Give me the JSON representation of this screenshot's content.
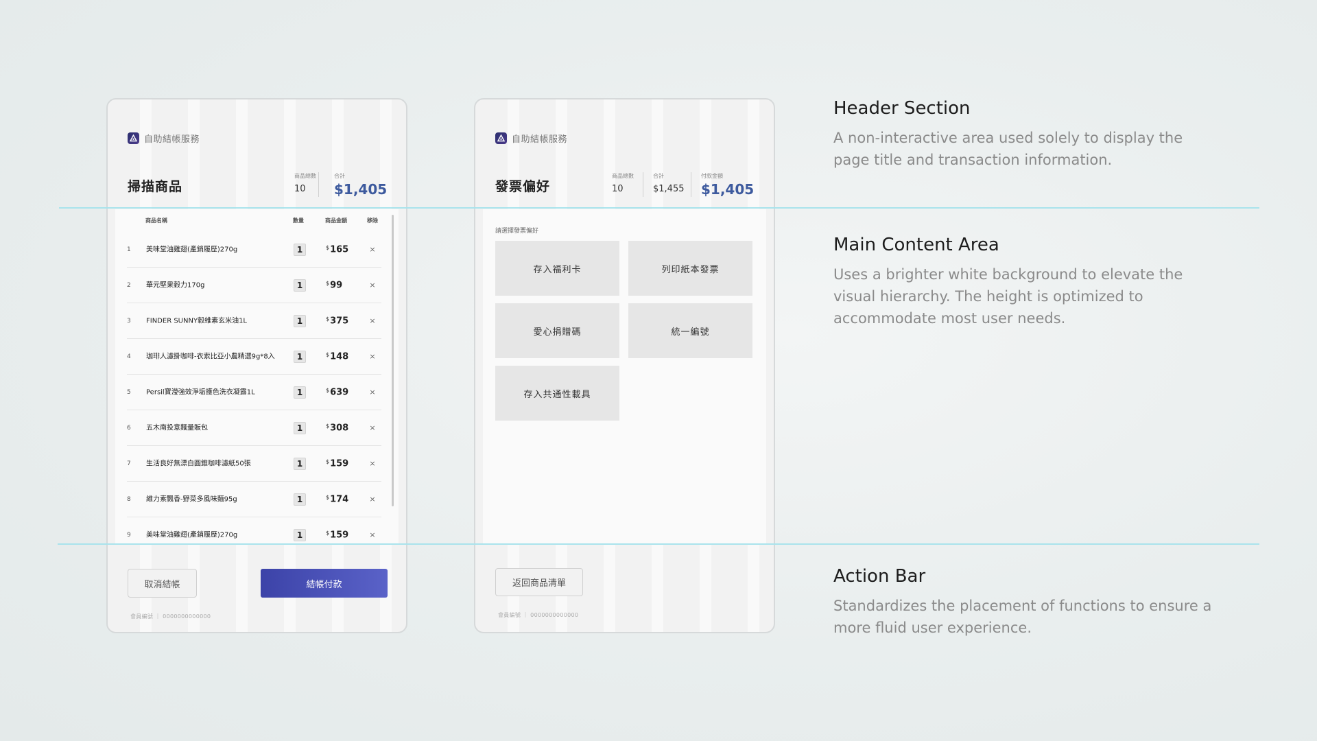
{
  "service_name": "自助結帳服務",
  "screen1": {
    "title": "掃描商品",
    "total_items_label": "商品總數",
    "total_items": "10",
    "total_label": "合計",
    "total": "$1,405",
    "columns": {
      "name": "商品名稱",
      "qty": "數量",
      "amount": "商品金額",
      "remove": "移除"
    },
    "items": [
      {
        "no": "1",
        "name": "美味堂油雞翅(產銷履歷)270g",
        "qty": "1",
        "price": "165"
      },
      {
        "no": "2",
        "name": "華元堅果穀力170g",
        "qty": "1",
        "price": "99"
      },
      {
        "no": "3",
        "name": "FINDER SUNNY穀維素玄米油1L",
        "qty": "1",
        "price": "375"
      },
      {
        "no": "4",
        "name": "珈琲人濾掛咖啡-衣索比亞小農精選9g*8入",
        "qty": "1",
        "price": "148"
      },
      {
        "no": "5",
        "name": "Persil寶瀅強效淨垢護色洗衣凝露1L",
        "qty": "1",
        "price": "639"
      },
      {
        "no": "6",
        "name": "五木南投意麵量販包",
        "qty": "1",
        "price": "308"
      },
      {
        "no": "7",
        "name": "生活良好無漂白圓錐咖啡濾紙50張",
        "qty": "1",
        "price": "159"
      },
      {
        "no": "8",
        "name": "維力素飄香-野菜多風味麵95g",
        "qty": "1",
        "price": "174"
      },
      {
        "no": "9",
        "name": "美味堂油雞翅(產銷履歷)270g",
        "qty": "1",
        "price": "159"
      }
    ],
    "currency_symbol": "$",
    "remove_symbol": "×",
    "cancel_label": "取消結帳",
    "pay_label": "結帳付款",
    "member_note": "會員編號 ｜ 0000000000000"
  },
  "screen2": {
    "title": "發票偏好",
    "total_items_label": "商品總數",
    "total_items": "10",
    "subtotal_label": "合計",
    "subtotal": "$1,455",
    "pay_amount_label": "付款金額",
    "pay_amount": "$1,405",
    "prompt": "請選擇發票偏好",
    "options": [
      "存入福利卡",
      "列印紙本發票",
      "愛心捐贈碼",
      "統一編號",
      "存入共通性載具"
    ],
    "back_label": "返回商品清單",
    "member_note": "會員編號 ｜ 0000000000000"
  },
  "descriptions": [
    {
      "title": "Header Section",
      "text": "A non-interactive area used solely to display the page title and transaction information."
    },
    {
      "title": "Main Content Area",
      "text": "Uses a brighter white background to elevate the visual hierarchy. The height is optimized to accommodate most user needs."
    },
    {
      "title": "Action Bar",
      "text": "Standardizes the placement of functions to ensure a more fluid user experience."
    }
  ],
  "colors": {
    "accent": "#3d5a9e",
    "pay_button": "#4a50b8",
    "guide_line": "#a9e3ec"
  }
}
